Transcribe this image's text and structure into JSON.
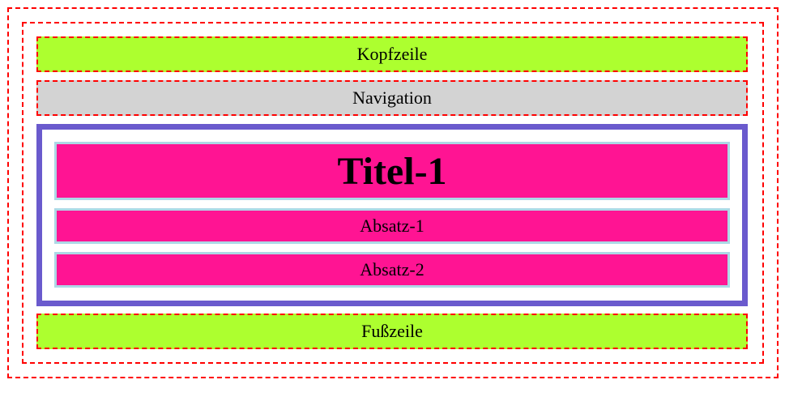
{
  "header": {
    "label": "Kopfzeile"
  },
  "navigation": {
    "label": "Navigation"
  },
  "main": {
    "title": "Titel-1",
    "paragraphs": [
      "Absatz-1",
      "Absatz-2"
    ]
  },
  "footer": {
    "label": "Fußzeile"
  },
  "colors": {
    "header": "#adff2f",
    "navigation": "#d3d3d3",
    "content": "#ff1493",
    "main_border": "#6a5acd",
    "dashed_border": "#ff0000",
    "box_border": "#add8e6"
  }
}
